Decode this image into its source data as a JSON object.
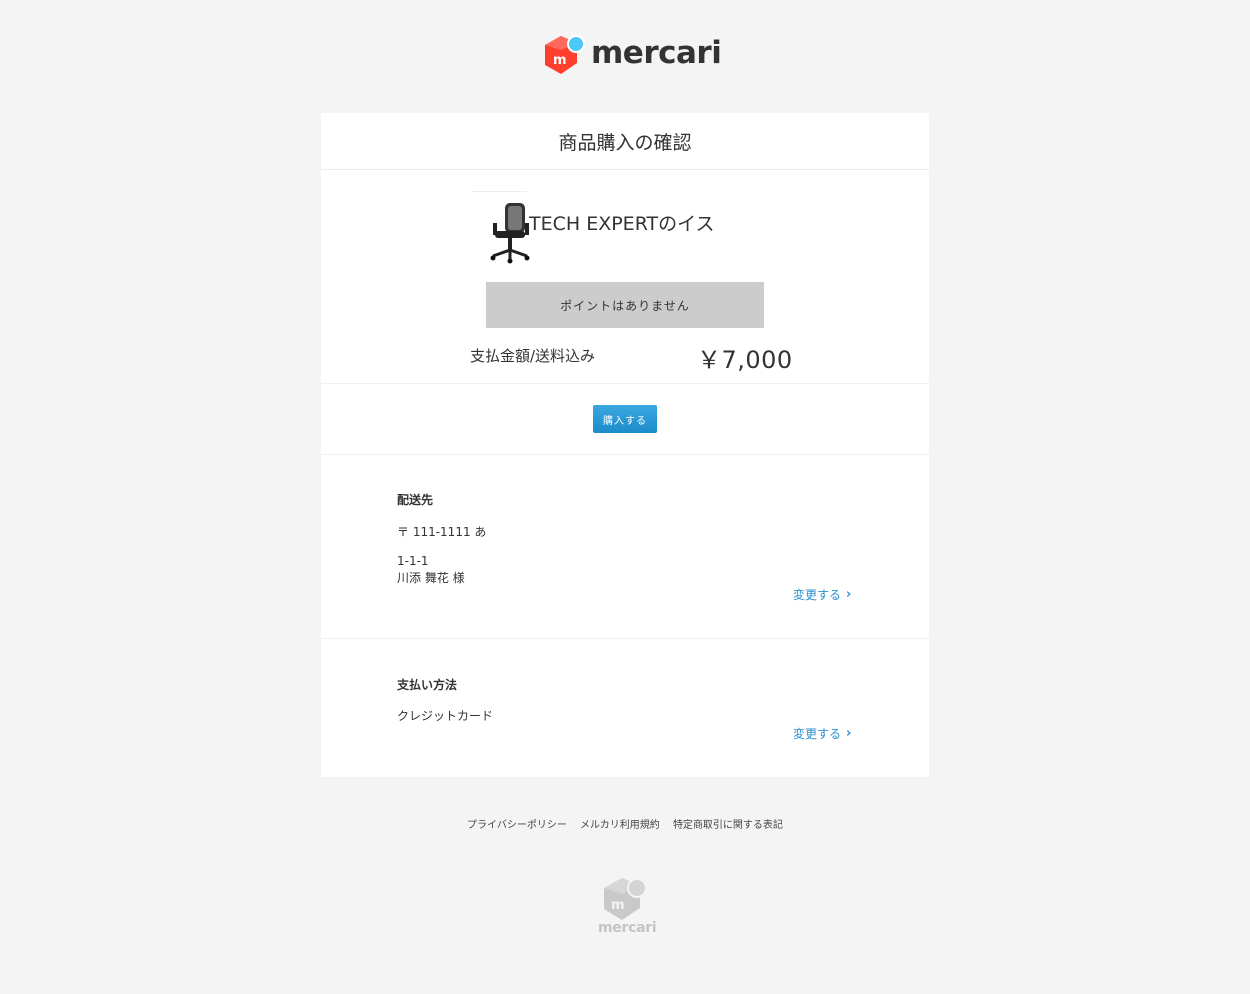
{
  "header": {
    "logo_text": "mercari"
  },
  "page": {
    "title": "商品購入の確認"
  },
  "item": {
    "name": "TECH EXPERTのイス"
  },
  "points": {
    "label": "ポイントはありません"
  },
  "total": {
    "label": "支払金額/送料込み",
    "value": "￥7,000"
  },
  "actions": {
    "buy_label": "購入する"
  },
  "shipping": {
    "title": "配送先",
    "postal_line": "〒 111-1111 あ",
    "address_line": "1-1-1",
    "name_line": "川添 舞花 様",
    "change_label": "変更する"
  },
  "payment": {
    "title": "支払い方法",
    "method": "クレジットカード",
    "change_label": "変更する"
  },
  "footer": {
    "links": [
      "プライバシーポリシー",
      "メルカリ利用規約",
      "特定商取引に関する表記"
    ],
    "logo_text": "mercari"
  },
  "colors": {
    "brand_red": "#ff3f2e",
    "brand_blue": "#4dc7f5",
    "link_blue": "#2b8fd0",
    "button_blue": "#1e8ccb"
  },
  "icons": [
    "mercari-logo-icon",
    "chair-image",
    "chevron-right-icon"
  ]
}
